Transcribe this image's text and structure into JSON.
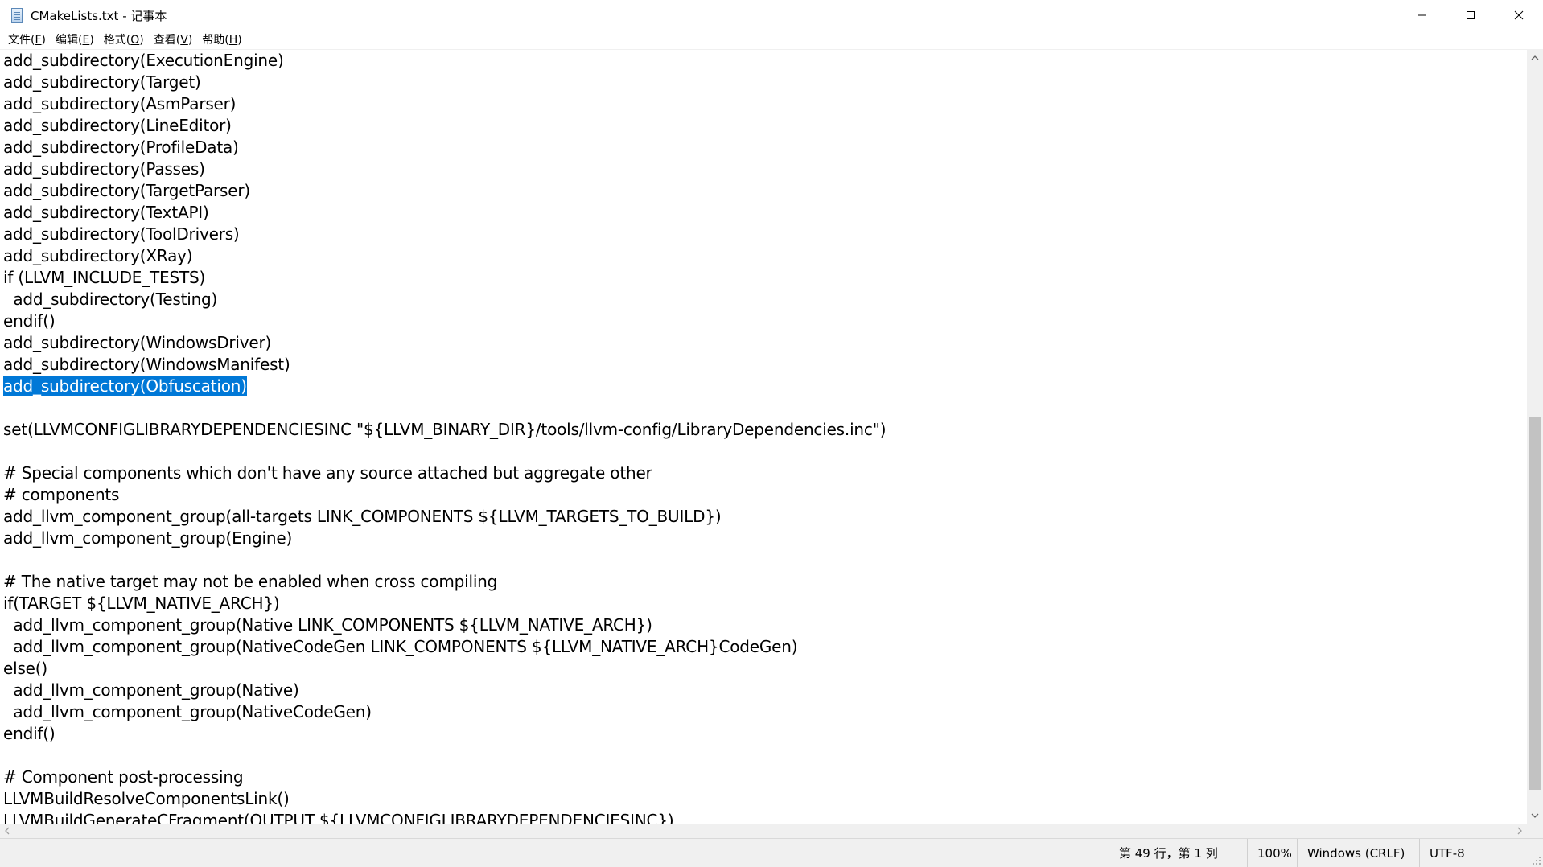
{
  "window": {
    "title": "CMakeLists.txt - 记事本",
    "controls": {
      "minimize": "minimize-icon",
      "maximize": "maximize-icon",
      "close": "close-icon"
    }
  },
  "menu": [
    {
      "label": "文件(",
      "mnemonic": "F",
      "suffix": ")"
    },
    {
      "label": "编辑(",
      "mnemonic": "E",
      "suffix": ")"
    },
    {
      "label": "格式(",
      "mnemonic": "O",
      "suffix": ")"
    },
    {
      "label": "查看(",
      "mnemonic": "V",
      "suffix": ")"
    },
    {
      "label": "帮助(",
      "mnemonic": "H",
      "suffix": ")"
    }
  ],
  "editor": {
    "lines": [
      "add_subdirectory(ExecutionEngine)",
      "add_subdirectory(Target)",
      "add_subdirectory(AsmParser)",
      "add_subdirectory(LineEditor)",
      "add_subdirectory(ProfileData)",
      "add_subdirectory(Passes)",
      "add_subdirectory(TargetParser)",
      "add_subdirectory(TextAPI)",
      "add_subdirectory(ToolDrivers)",
      "add_subdirectory(XRay)",
      "if (LLVM_INCLUDE_TESTS)",
      "  add_subdirectory(Testing)",
      "endif()",
      "add_subdirectory(WindowsDriver)",
      "add_subdirectory(WindowsManifest)",
      "add_subdirectory(Obfuscation)",
      "",
      "set(LLVMCONFIGLIBRARYDEPENDENCIESINC \"${LLVM_BINARY_DIR}/tools/llvm-config/LibraryDependencies.inc\")",
      "",
      "# Special components which don't have any source attached but aggregate other",
      "# components",
      "add_llvm_component_group(all-targets LINK_COMPONENTS ${LLVM_TARGETS_TO_BUILD})",
      "add_llvm_component_group(Engine)",
      "",
      "# The native target may not be enabled when cross compiling",
      "if(TARGET ${LLVM_NATIVE_ARCH})",
      "  add_llvm_component_group(Native LINK_COMPONENTS ${LLVM_NATIVE_ARCH})",
      "  add_llvm_component_group(NativeCodeGen LINK_COMPONENTS ${LLVM_NATIVE_ARCH}CodeGen)",
      "else()",
      "  add_llvm_component_group(Native)",
      "  add_llvm_component_group(NativeCodeGen)",
      "endif()",
      "",
      "# Component post-processing",
      "LLVMBuildResolveComponentsLink()",
      "LLVMBuildGenerateCFragment(OUTPUT ${LLVMCONFIGLIBRARYDEPENDENCIESINC})"
    ],
    "selected_line_index": 15,
    "selection_color": "#0078d7"
  },
  "status": {
    "position": "第 49 行，第 1 列",
    "zoom": "100%",
    "line_ending": "Windows (CRLF)",
    "encoding": "UTF-8"
  }
}
